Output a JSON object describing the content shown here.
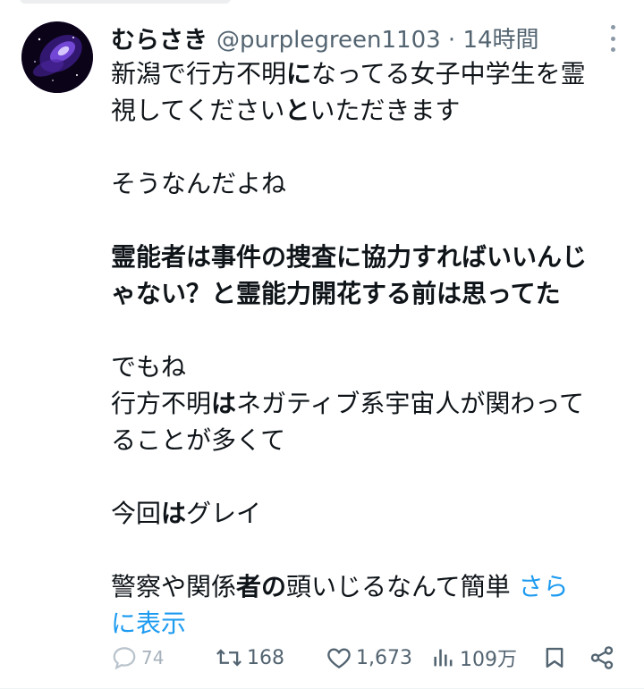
{
  "tweet": {
    "display_name": "むらさき",
    "handle": "@purplegreen1103",
    "time": "· 14時間",
    "lines": [
      {
        "segments": [
          {
            "t": "新潟で行方不明",
            "b": false
          },
          {
            "t": "に",
            "b": true
          },
          {
            "t": "なってる女子中学生を霊",
            "b": false
          }
        ]
      },
      {
        "segments": [
          {
            "t": "視してください",
            "b": false
          },
          {
            "t": "と",
            "b": true
          },
          {
            "t": "いただきます",
            "b": false
          }
        ]
      },
      {
        "blank": true
      },
      {
        "segments": [
          {
            "t": "そうなんだよね",
            "b": false
          }
        ]
      },
      {
        "blank": true
      },
      {
        "segments": [
          {
            "t": "霊能者は事件の捜査に協力すればいいんじ",
            "b": true
          }
        ]
      },
      {
        "segments": [
          {
            "t": "ゃない？と霊能力開花する前は思ってた",
            "b": true
          }
        ]
      },
      {
        "blank": true
      },
      {
        "segments": [
          {
            "t": "でもね",
            "b": false
          }
        ]
      },
      {
        "segments": [
          {
            "t": "行方不明",
            "b": false
          },
          {
            "t": "は",
            "b": true
          },
          {
            "t": "ネガティブ系宇宙人が関わって",
            "b": false
          }
        ]
      },
      {
        "segments": [
          {
            "t": "ることが多くて",
            "b": false
          }
        ]
      },
      {
        "blank": true
      },
      {
        "segments": [
          {
            "t": "今回",
            "b": false
          },
          {
            "t": "は",
            "b": true
          },
          {
            "t": "グレイ",
            "b": false
          }
        ]
      },
      {
        "blank": true
      },
      {
        "segments": [
          {
            "t": "警察や関係",
            "b": false
          },
          {
            "t": "者の",
            "b": true
          },
          {
            "t": "頭いじるなんて簡単 ",
            "b": false
          },
          {
            "t": "さら",
            "b": false,
            "link": true
          }
        ]
      },
      {
        "segments": [
          {
            "t": "に表示",
            "b": false,
            "link": true
          }
        ]
      }
    ]
  },
  "actions": {
    "reply_count": "74",
    "retweet_count": "168",
    "like_count": "1,673",
    "views_count": "109万"
  },
  "icons": {
    "reply": "reply-icon",
    "retweet": "retweet-icon",
    "like": "heart-icon",
    "views": "views-icon",
    "bookmark": "bookmark-icon",
    "share": "share-icon",
    "more": "more-icon"
  },
  "colors": {
    "text": "#0f1419",
    "muted": "#536471",
    "link": "#1d9bf0"
  }
}
